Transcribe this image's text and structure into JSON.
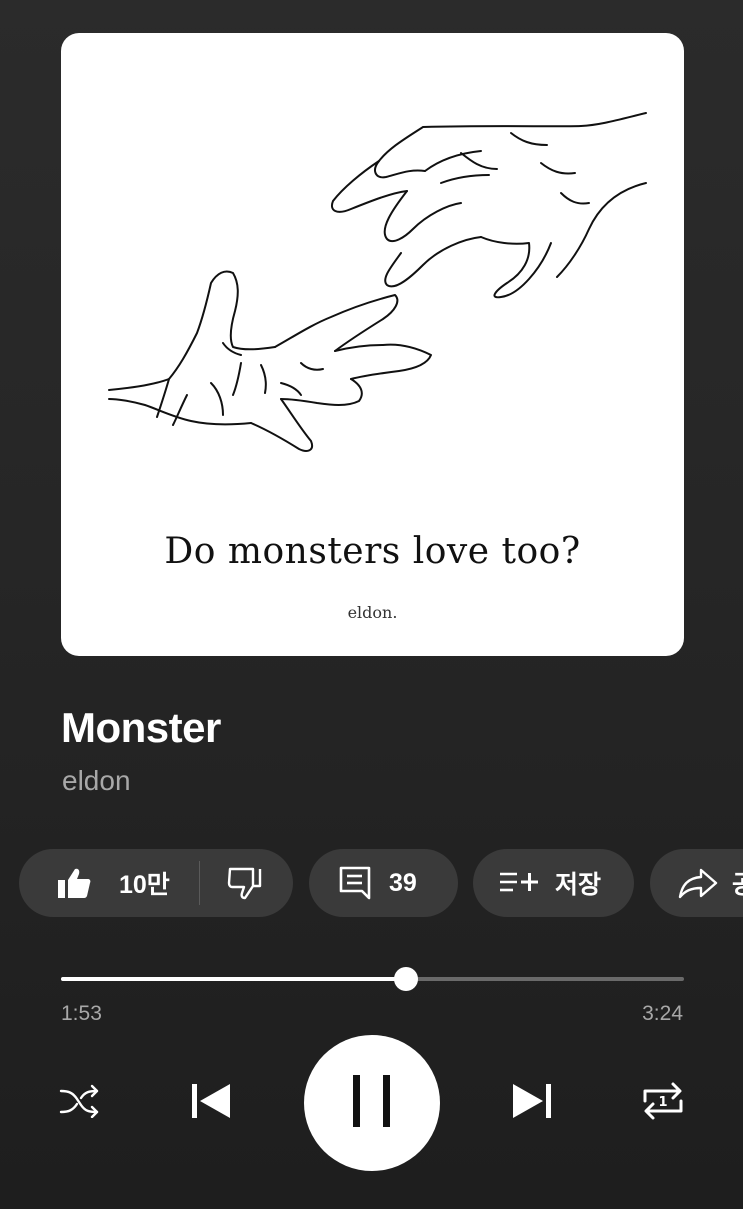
{
  "album": {
    "caption": "Do monsters love too?",
    "artist_signature": "eldon."
  },
  "song": {
    "title": "Monster",
    "artist": "eldon"
  },
  "actions": {
    "like_count": "10만",
    "comment_count": "39",
    "save_label": "저장",
    "share_label": "공"
  },
  "player": {
    "elapsed": "1:53",
    "total": "3:24",
    "progress_fraction": 0.554
  },
  "icons": {
    "like": "thumbs-up-icon",
    "dislike": "thumbs-down-icon",
    "comment": "comment-icon",
    "save": "playlist-add-icon",
    "share": "share-icon",
    "shuffle": "shuffle-icon",
    "previous": "skip-previous-icon",
    "play_pause": "pause-icon",
    "next": "skip-next-icon",
    "repeat": "repeat-one-icon"
  }
}
